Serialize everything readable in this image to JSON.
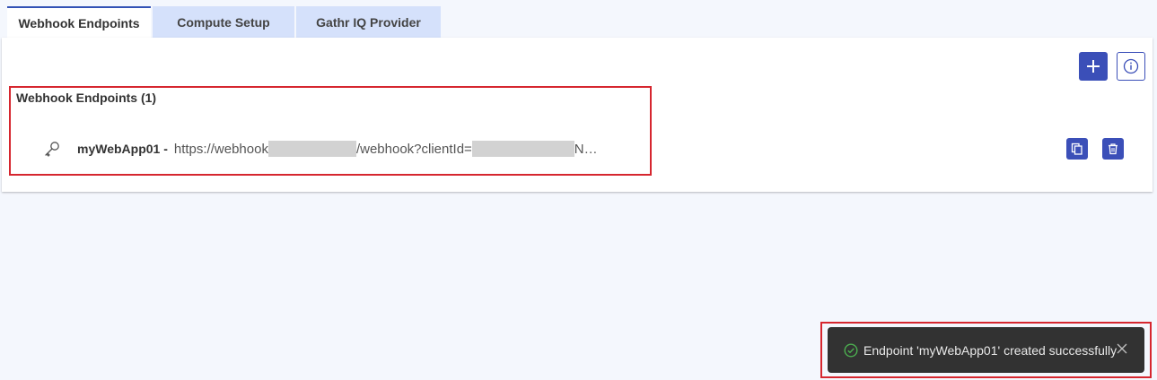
{
  "tabs": [
    {
      "label": "Webhook Endpoints",
      "active": true
    },
    {
      "label": "Compute Setup",
      "active": false
    },
    {
      "label": "Gathr IQ Provider",
      "active": false
    }
  ],
  "toolbar": {
    "add_icon": "plus-icon",
    "info_icon": "info-icon"
  },
  "section": {
    "title": "Webhook Endpoints (1)"
  },
  "endpoints": [
    {
      "name": "myWebApp01 -",
      "url_part1": "https://webhook",
      "url_part2": "/webhook?clientId=",
      "url_part3": "N…",
      "key_icon": "key-icon",
      "actions": [
        "copy-icon",
        "trash-icon"
      ]
    }
  ],
  "toast": {
    "message": "Endpoint 'myWebApp01' created successfully",
    "status_icon": "check-circle-icon",
    "close_icon": "close-icon"
  },
  "colors": {
    "accent": "#3b4fb8",
    "tab_inactive": "#d5e1fb",
    "highlight": "#d6262f",
    "toast_bg": "#323232",
    "success": "#4caf50",
    "background": "#f4f7fd"
  }
}
